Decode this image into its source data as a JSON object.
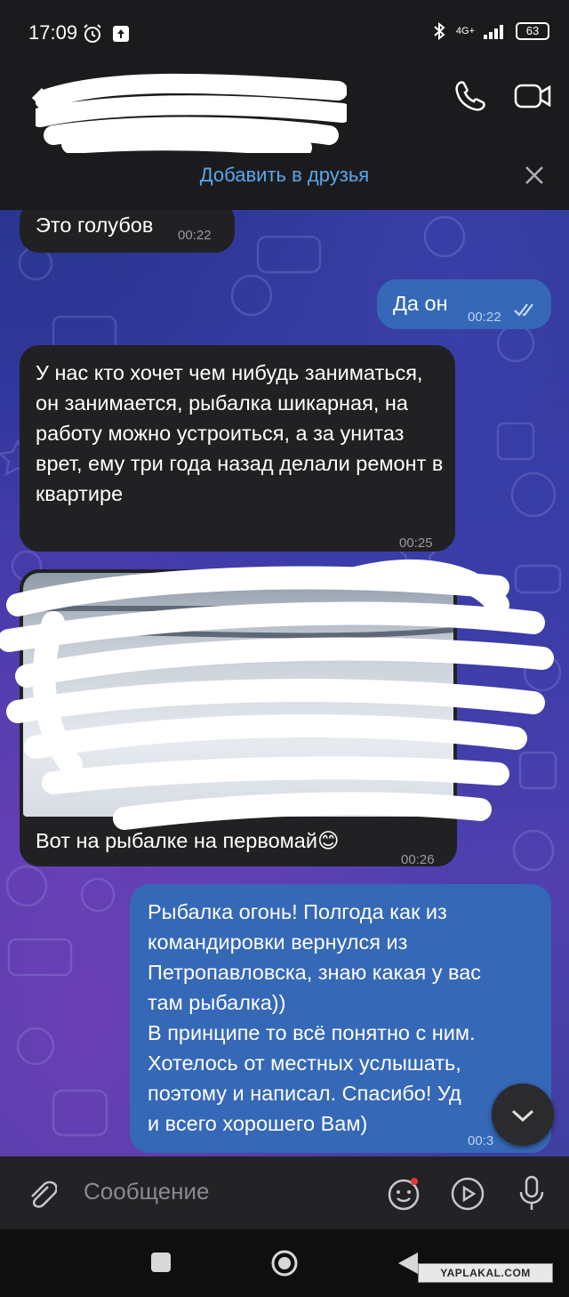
{
  "status_bar": {
    "time": "17:09",
    "network": "4G+",
    "battery": "63"
  },
  "header": {
    "add_friend_label": "Добавить в друзья",
    "icons": [
      "back-arrow-icon",
      "phone-icon",
      "video-camera-icon",
      "close-icon"
    ]
  },
  "messages": [
    {
      "direction": "in",
      "text": "Это голубов",
      "time": "00:22"
    },
    {
      "direction": "out",
      "text": "Да он",
      "time": "00:22",
      "read": true
    },
    {
      "direction": "in",
      "text": "У нас кто хочет чем нибудь заниматься, он занимается, рыбалка шикарная, на работу можно устроиться, а за унитаз врет, ему три года назад делали ремонт в квартире",
      "time": "00:25"
    },
    {
      "direction": "in",
      "type": "photo",
      "caption": "Вот на рыбалке на первомай",
      "emoji": "😊",
      "time": "00:26"
    },
    {
      "direction": "out",
      "lines": [
        "Рыбалка огонь! Полгода как из",
        "командировки вернулся из",
        "Петропавловска, знаю какая у вас",
        "там рыбалка))",
        "В принципе то всё понятно с ним.",
        "Хотелось от местных услышать,",
        "поэтому и написал. Спасибо! Уд",
        "и всего хорошего Вам)"
      ],
      "time": "00:3"
    }
  ],
  "composer": {
    "placeholder": "Сообщение"
  },
  "watermark": "YAPLAKAL.COM",
  "colors": {
    "incoming_bubble": "#212123",
    "outgoing_bubble": "#3568b7",
    "accent": "#5aa7ee"
  }
}
